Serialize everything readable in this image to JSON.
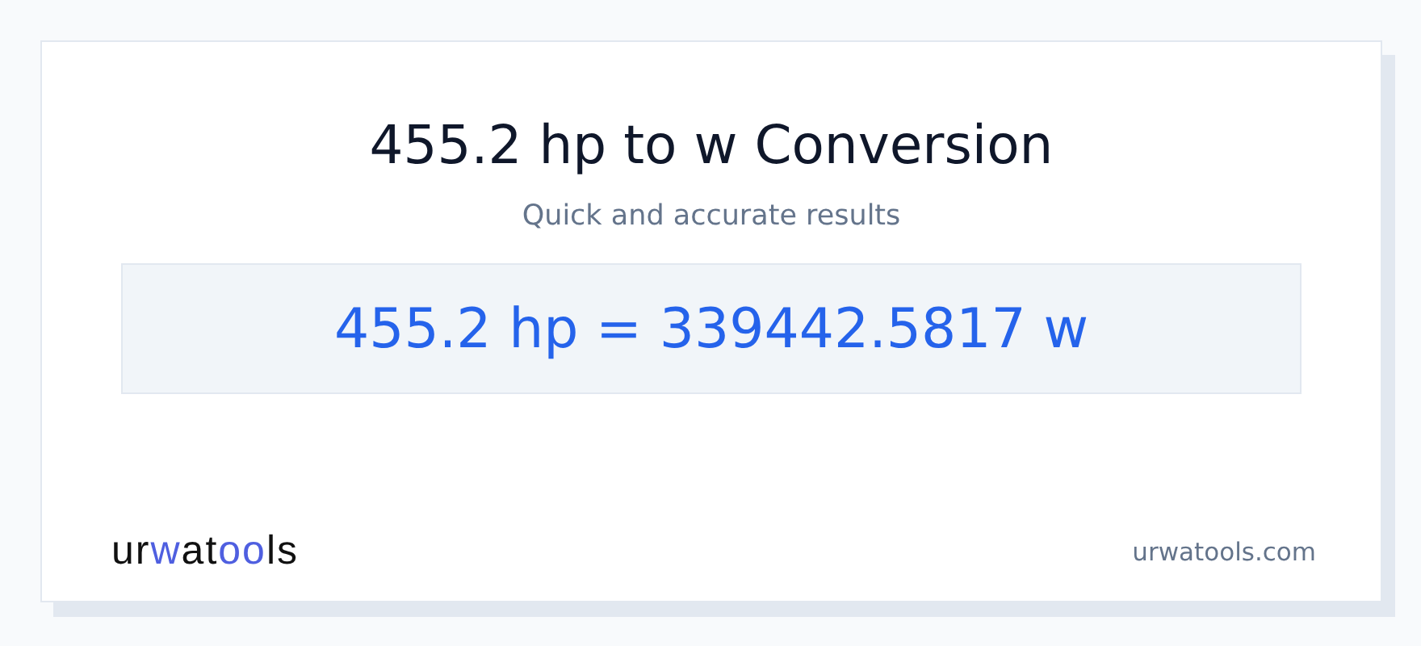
{
  "title": "455.2 hp to w Conversion",
  "subtitle": "Quick and accurate results",
  "result": "455.2 hp = 339442.5817 w",
  "logo": [
    {
      "text": "ur",
      "accent": false
    },
    {
      "text": "w",
      "accent": true
    },
    {
      "text": "at",
      "accent": false
    },
    {
      "text": "oo",
      "accent": true
    },
    {
      "text": "ls",
      "accent": false
    }
  ],
  "site": "urwatools.com"
}
